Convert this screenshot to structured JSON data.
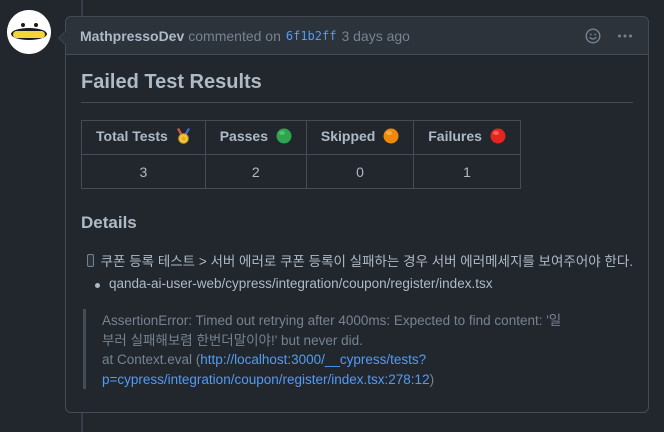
{
  "comment": {
    "author": "MathpressoDev",
    "action": "commented on",
    "commit_sha": "6f1b2ff",
    "time_ago": "3 days ago",
    "icons": {
      "reaction": "smiley-icon",
      "menu": "kebab-icon"
    }
  },
  "report": {
    "title": "Failed Test Results",
    "table": {
      "headers": [
        {
          "label": "Total Tests",
          "icon": "medal-icon"
        },
        {
          "label": "Passes",
          "icon": "green-circle-icon"
        },
        {
          "label": "Skipped",
          "icon": "orange-circle-icon"
        },
        {
          "label": "Failures",
          "icon": "red-circle-icon"
        }
      ],
      "values": [
        "3",
        "2",
        "0",
        "1"
      ]
    },
    "details_heading": "Details",
    "task": {
      "checked": false,
      "text": "쿠폰 등록 테스트 > 서버 에러로 쿠폰 등록이 실패하는 경우 서버 에러메세지를 보여주어야 한다."
    },
    "file": "qanda-ai-user-web/cypress/integration/coupon/register/index.tsx",
    "error": {
      "message": "AssertionError: Timed out retrying after 4000ms: Expected to find content: '일부러 실패해보렴 한번더말이야!' but never did.",
      "at_prefix": "at Context.eval (",
      "link": "http://localhost:3000/__cypress/tests?p=cypress/integration/coupon/register/index.tsx:278:12",
      "at_suffix": ")"
    }
  },
  "colors": {
    "background": "#22272e",
    "header_bg": "#2d333b",
    "border": "#444c56",
    "link": "#539bf5",
    "muted": "#768390",
    "text": "#adbac7"
  }
}
